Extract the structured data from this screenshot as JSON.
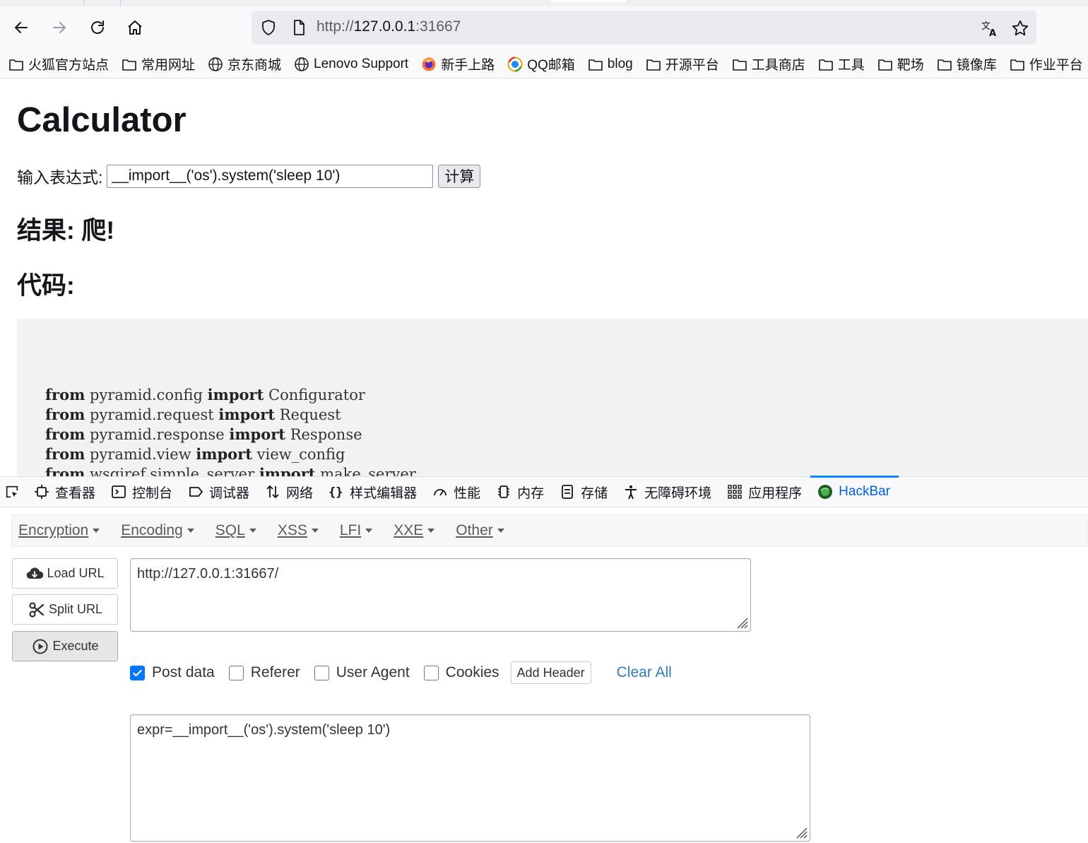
{
  "browser": {
    "url_prefix": "http://",
    "url_host": "127.0.0.1",
    "url_port": ":31667",
    "bookmarks": [
      {
        "label": "火狐官方站点",
        "icon": "folder-icon"
      },
      {
        "label": "常用网址",
        "icon": "folder-icon"
      },
      {
        "label": "京东商城",
        "icon": "globe-icon"
      },
      {
        "label": "Lenovo Support",
        "icon": "globe-icon"
      },
      {
        "label": "新手上路",
        "icon": "firefox-icon"
      },
      {
        "label": "QQ邮箱",
        "icon": "qqmail-icon"
      },
      {
        "label": "blog",
        "icon": "folder-icon"
      },
      {
        "label": "开源平台",
        "icon": "folder-icon"
      },
      {
        "label": "工具商店",
        "icon": "folder-icon"
      },
      {
        "label": "工具",
        "icon": "folder-icon"
      },
      {
        "label": "靶场",
        "icon": "folder-icon"
      },
      {
        "label": "镜像库",
        "icon": "folder-icon"
      },
      {
        "label": "作业平台",
        "icon": "folder-icon"
      }
    ]
  },
  "page": {
    "title": "Calculator",
    "input_label": "输入表达式:",
    "input_value": "__import__('os').system('sleep 10')",
    "submit_label": "计算",
    "result_heading": "结果: 爬!",
    "code_heading": "代码:",
    "code_lines": [
      {
        "kw1": "from",
        "mod": " pyramid.config ",
        "kw2": "import",
        "name": " Configurator"
      },
      {
        "kw1": "from",
        "mod": " pyramid.request ",
        "kw2": "import",
        "name": " Request"
      },
      {
        "kw1": "from",
        "mod": " pyramid.response ",
        "kw2": "import",
        "name": " Response"
      },
      {
        "kw1": "from",
        "mod": " pyramid.view ",
        "kw2": "import",
        "name": " view_config"
      },
      {
        "kw1": "from",
        "mod": " wsgiref.simple_server ",
        "kw2": "import",
        "name": " make_server"
      }
    ]
  },
  "devtools": {
    "tabs": [
      {
        "label": "查看器",
        "icon": "inspector-icon"
      },
      {
        "label": "控制台",
        "icon": "console-icon"
      },
      {
        "label": "调试器",
        "icon": "debugger-icon"
      },
      {
        "label": "网络",
        "icon": "network-icon"
      },
      {
        "label": "样式编辑器",
        "icon": "style-editor-icon"
      },
      {
        "label": "性能",
        "icon": "performance-icon"
      },
      {
        "label": "内存",
        "icon": "memory-icon"
      },
      {
        "label": "存储",
        "icon": "storage-icon"
      },
      {
        "label": "无障碍环境",
        "icon": "accessibility-icon"
      },
      {
        "label": "应用程序",
        "icon": "application-icon"
      },
      {
        "label": "HackBar",
        "icon": "hackbar-icon"
      }
    ],
    "active_tab": "HackBar"
  },
  "hackbar": {
    "menu": [
      "Encryption",
      "Encoding",
      "SQL",
      "XSS",
      "LFI",
      "XXE",
      "Other"
    ],
    "load_url": "Load URL",
    "split_url": "Split URL",
    "execute": "Execute",
    "url_value": "http://127.0.0.1:31667/",
    "post_data_label": "Post data",
    "referer_label": "Referer",
    "user_agent_label": "User Agent",
    "cookies_label": "Cookies",
    "post_data_checked": true,
    "referer_checked": false,
    "user_agent_checked": false,
    "cookies_checked": false,
    "add_header": "Add Header",
    "clear_all": "Clear All",
    "post_body": "expr=__import__('os').system('sleep 10')"
  },
  "colors": {
    "accent": "#0a84ff",
    "link": "#337ab7",
    "checkbox": "#0075ff"
  }
}
